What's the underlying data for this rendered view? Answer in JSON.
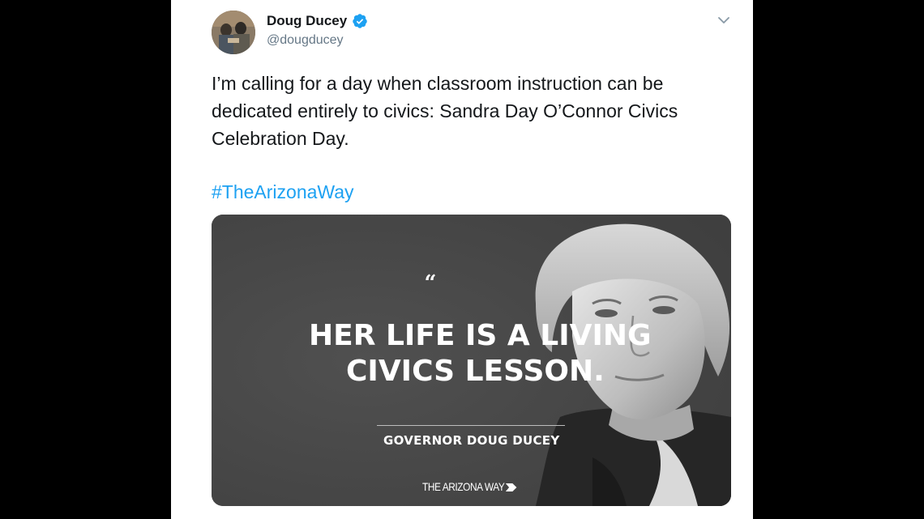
{
  "tweet": {
    "author": {
      "name": "Doug Ducey",
      "handle": "@dougducey",
      "verified": true
    },
    "text": "I’m calling for a day when classroom instruction can be dedicated entirely to civics: Sandra Day O’Connor Civics Celebration Day.",
    "hashtag": "#TheArizonaWay",
    "media": {
      "quote_mark": "“",
      "headline_line1": "HER LIFE IS A LIVING",
      "headline_line2": "CIVICS LESSON.",
      "attribution": "GOVERNOR DOUG DUCEY",
      "brand": "THE ARIZONA WAY"
    }
  },
  "colors": {
    "link": "#1da1f2",
    "text": "#14171a",
    "secondary": "#657786",
    "verified": "#1da1f2",
    "media_background": "#4a4a4a"
  },
  "icons": {
    "verified": "verified-badge-icon",
    "menu": "chevron-down-icon",
    "brand_arrow": "arrow-right-icon"
  }
}
